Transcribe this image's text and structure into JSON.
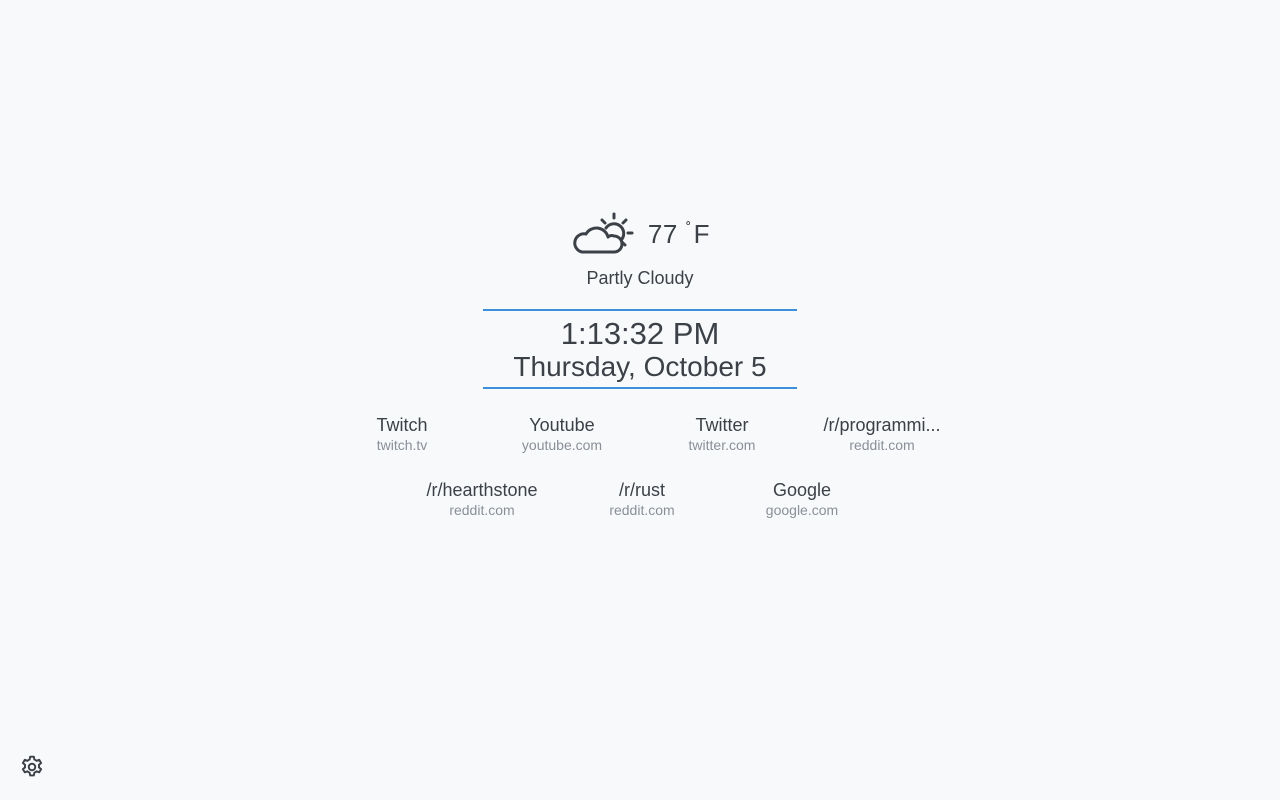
{
  "weather": {
    "icon": "partly-cloudy-icon",
    "temperature": "77",
    "degree_symbol": "˚",
    "unit": "F",
    "condition": "Partly Cloudy"
  },
  "clock": {
    "time": "1:13:32 PM",
    "date": "Thursday, October 5"
  },
  "accent_color": "#3d8fdc",
  "links": [
    {
      "name": "Twitch",
      "url": "twitch.tv"
    },
    {
      "name": "Youtube",
      "url": "youtube.com"
    },
    {
      "name": "Twitter",
      "url": "twitter.com"
    },
    {
      "name": "/r/programmi...",
      "url": "reddit.com"
    },
    {
      "name": "/r/hearthstone",
      "url": "reddit.com"
    },
    {
      "name": "/r/rust",
      "url": "reddit.com"
    },
    {
      "name": "Google",
      "url": "google.com"
    }
  ],
  "settings": {
    "icon": "gear-icon"
  }
}
